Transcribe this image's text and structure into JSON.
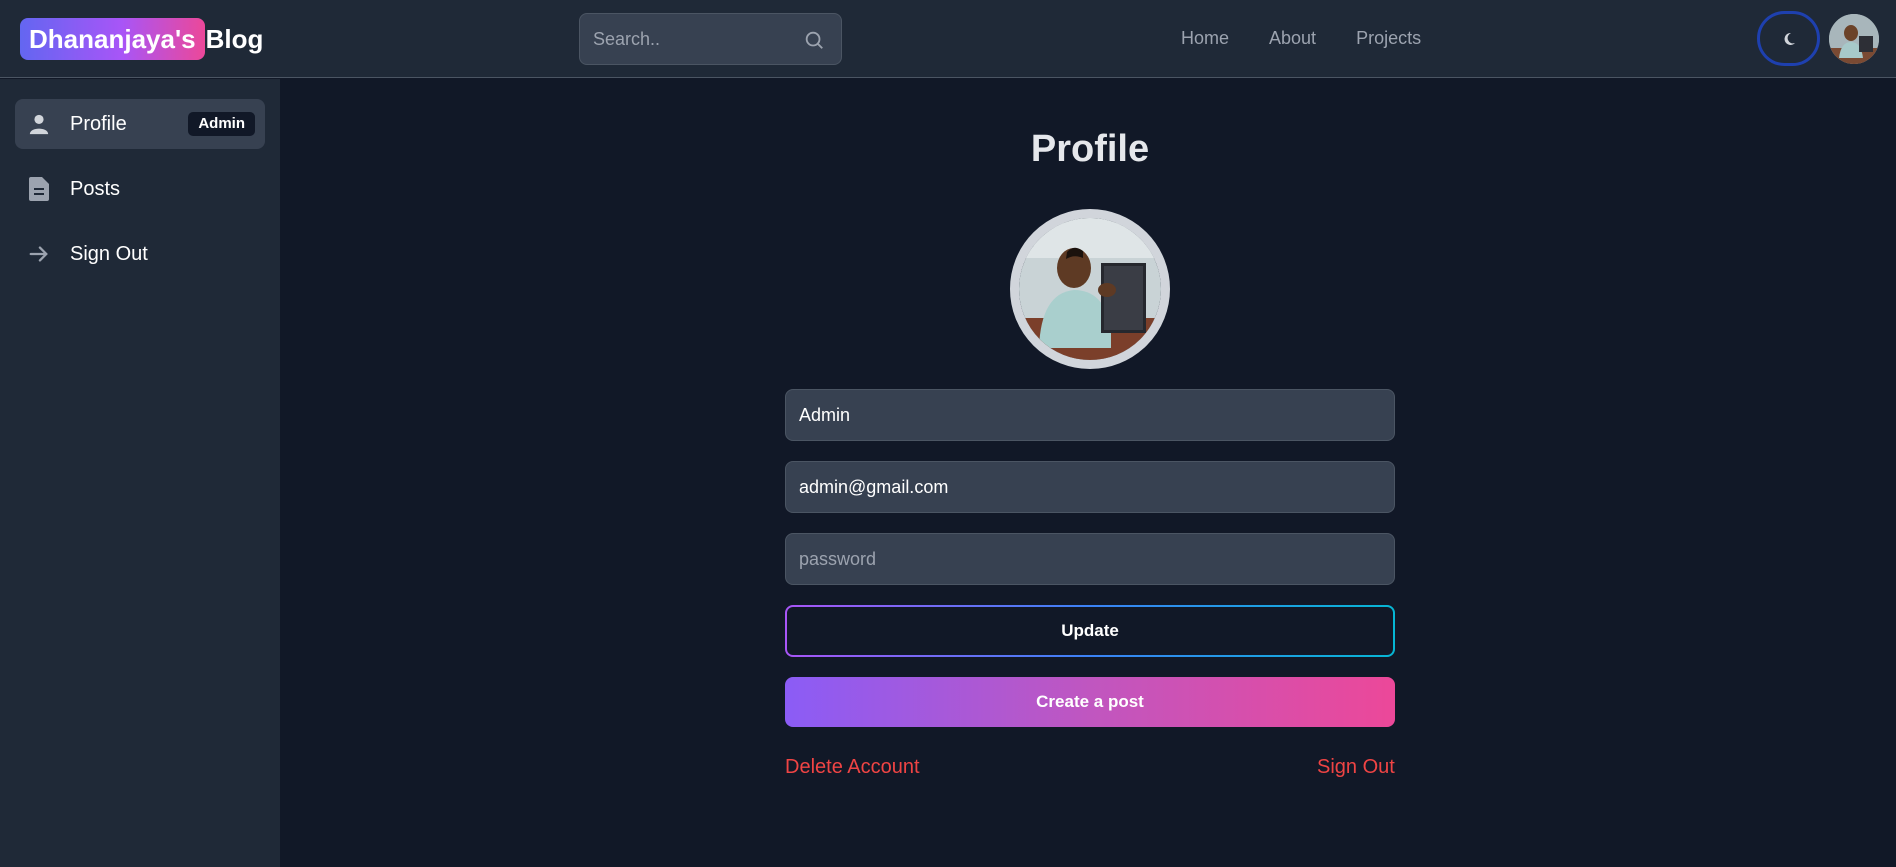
{
  "header": {
    "logo_highlight": "Dhananjaya's",
    "logo_rest": "Blog",
    "search_placeholder": "Search..",
    "nav": [
      "Home",
      "About",
      "Projects"
    ],
    "theme_icon": "moon-icon"
  },
  "sidebar": {
    "items": [
      {
        "label": "Profile",
        "icon": "user-icon",
        "badge": "Admin"
      },
      {
        "label": "Posts",
        "icon": "document-icon"
      },
      {
        "label": "Sign Out",
        "icon": "arrow-right-icon"
      }
    ]
  },
  "main": {
    "title": "Profile",
    "username_value": "Admin",
    "email_value": "admin@gmail.com",
    "password_placeholder": "password",
    "update_label": "Update",
    "create_post_label": "Create a post",
    "delete_label": "Delete Account",
    "signout_label": "Sign Out"
  },
  "colors": {
    "page_bg": "#111827",
    "panel_bg": "#1f2937",
    "input_bg": "#374151",
    "danger": "#ef4444",
    "accent_purple": "#8b5cf6",
    "accent_pink": "#ec4899"
  }
}
